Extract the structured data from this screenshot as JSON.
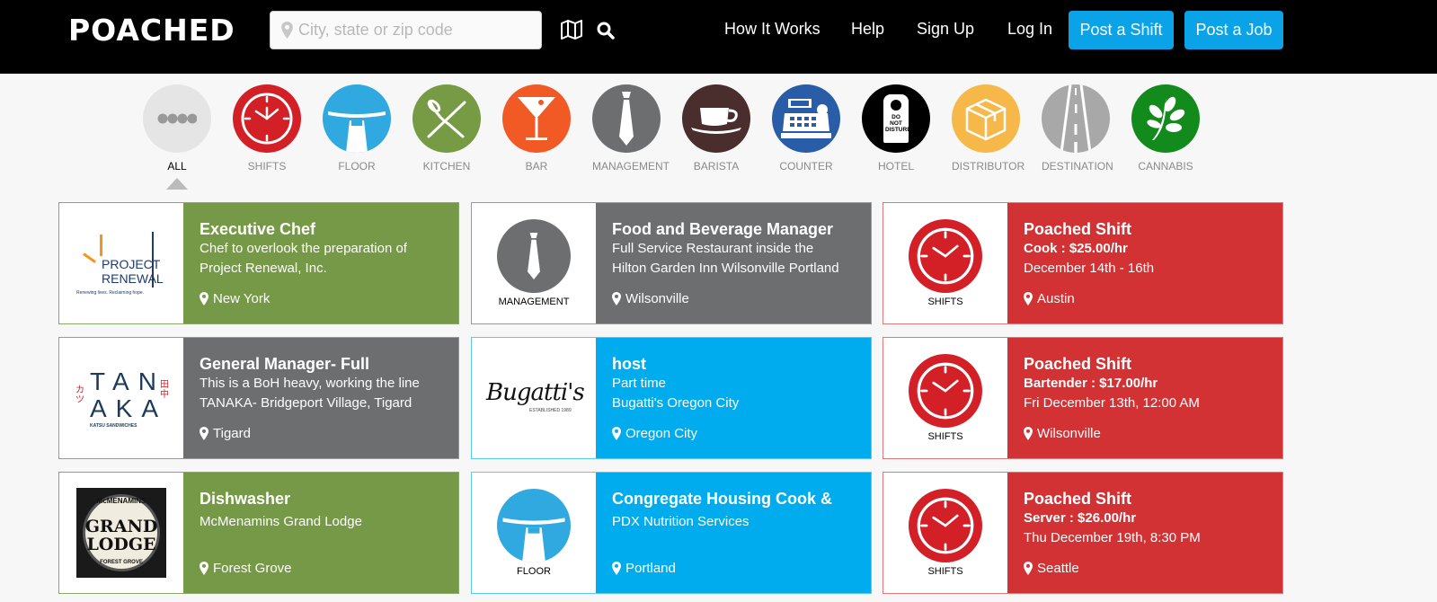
{
  "header": {
    "logo": "POACHED",
    "search_placeholder": "City, state or zip code",
    "nav": [
      "How It Works",
      "Help",
      "Sign Up",
      "Log In"
    ],
    "post_shift": "Post a Shift",
    "post_job": "Post a Job"
  },
  "categories": [
    {
      "label": "ALL",
      "color": "#e5e5e5",
      "icon": "dots-icon"
    },
    {
      "label": "SHIFTS",
      "color": "#d32027",
      "icon": "clock-icon"
    },
    {
      "label": "FLOOR",
      "color": "#2fa9e0",
      "icon": "tray-icon"
    },
    {
      "label": "KITCHEN",
      "color": "#779b45",
      "icon": "utensils-icon"
    },
    {
      "label": "BAR",
      "color": "#f15a24",
      "icon": "martini-icon"
    },
    {
      "label": "MANAGEMENT",
      "color": "#6d6e70",
      "icon": "tie-icon"
    },
    {
      "label": "BARISTA",
      "color": "#4a2e2e",
      "icon": "coffee-cup-icon"
    },
    {
      "label": "COUNTER",
      "color": "#2a5da8",
      "icon": "cash-register-icon"
    },
    {
      "label": "HOTEL",
      "color": "#000000",
      "icon": "door-hanger-icon"
    },
    {
      "label": "DISTRIBUTOR",
      "color": "#f7b84a",
      "icon": "box-icon"
    },
    {
      "label": "DESTINATION",
      "color": "#a8a8a8",
      "icon": "road-icon"
    },
    {
      "label": "CANNABIS",
      "color": "#138a1c",
      "icon": "leaf-icon"
    }
  ],
  "door_hanger_text": "DO NOT DISTURB",
  "cards": [
    {
      "title": "Executive Chef",
      "line1": "Chef to overlook the preparation of",
      "line2": "Project Renewal, Inc.",
      "location": "New York",
      "logo": {
        "type": "project-renewal",
        "name": "PROJECT RENEWAL",
        "tagline": "Renewing lives. Reclaiming hope."
      }
    },
    {
      "title": "Food and Beverage Manager",
      "line1": "Full Service Restaurant inside the",
      "line2": "Hilton Garden Inn Wilsonville Portland",
      "location": "Wilsonville",
      "logo": {
        "type": "management",
        "caption": "MANAGEMENT"
      }
    },
    {
      "title": "Poached Shift",
      "line1": "Cook : $25.00/hr",
      "line2": "December 14th - 16th",
      "location": "Austin",
      "logo": {
        "type": "shifts",
        "caption": "SHIFTS"
      }
    },
    {
      "title": "General Manager- Full",
      "line1": "This is a BoH heavy, working the line",
      "line2": "TANAKA- Bridgeport Village, Tigard",
      "location": "Tigard",
      "logo": {
        "type": "tanaka",
        "top": "TAN",
        "bottom": "AKA",
        "sub": "KATSU SANDWICHES"
      }
    },
    {
      "title": "host",
      "line1": "Part time",
      "line2": "Bugatti's Oregon City",
      "location": "Oregon City",
      "logo": {
        "type": "bugattis",
        "name": "Bugatti's",
        "sub": "ESTABLISHED 1989"
      }
    },
    {
      "title": "Poached Shift",
      "line1": "Bartender : $17.00/hr",
      "line2": "Fri December 13th, 12:00 AM",
      "location": "Wilsonville",
      "logo": {
        "type": "shifts",
        "caption": "SHIFTS"
      }
    },
    {
      "title": "Dishwasher",
      "line1": "McMenamins Grand Lodge",
      "line2": "",
      "location": "Forest Grove",
      "logo": {
        "type": "grand-lodge",
        "top": "McMENAMINS",
        "mid1": "GRAND",
        "mid2": "LODGE",
        "bottom": "FOREST GROVE"
      }
    },
    {
      "title": "Congregate Housing Cook &",
      "line1": "PDX Nutrition Services",
      "line2": "",
      "location": "Portland",
      "logo": {
        "type": "floor",
        "caption": "FLOOR"
      }
    },
    {
      "title": "Poached Shift",
      "line1": "Server : $26.00/hr",
      "line2": "Thu December 19th, 8:30 PM",
      "location": "Seattle",
      "logo": {
        "type": "shifts",
        "caption": "SHIFTS"
      }
    }
  ]
}
